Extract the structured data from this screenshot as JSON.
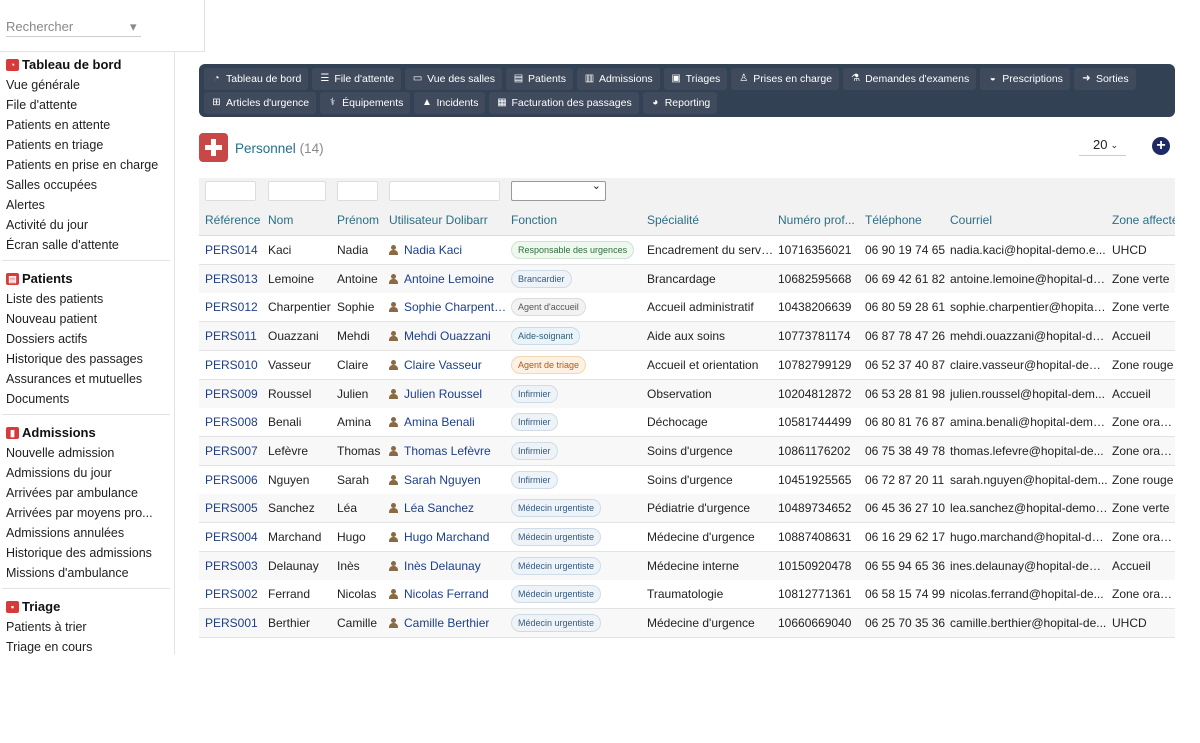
{
  "search": {
    "placeholder": "Rechercher"
  },
  "sidebar": {
    "sections": [
      {
        "title": "Tableau de bord",
        "icon": "dashboard-icon",
        "items": [
          "Vue générale",
          "File d'attente",
          "Patients en attente",
          "Patients en triage",
          "Patients en prise en charge",
          "Salles occupées",
          "Alertes",
          "Activité du jour",
          "Écran salle d'attente"
        ]
      },
      {
        "title": "Patients",
        "icon": "patient-card-icon",
        "items": [
          "Liste des patients",
          "Nouveau patient",
          "Dossiers actifs",
          "Historique des passages",
          "Assurances et mutuelles",
          "Documents"
        ]
      },
      {
        "title": "Admissions",
        "icon": "admissions-icon",
        "items": [
          "Nouvelle admission",
          "Admissions du jour",
          "Arrivées par ambulance",
          "Arrivées par moyens pro...",
          "Admissions annulées",
          "Historique des admissions",
          "Missions d'ambulance"
        ]
      },
      {
        "title": "Triage",
        "icon": "triage-icon",
        "items": [
          "Patients à trier",
          "Triage en cours"
        ]
      }
    ]
  },
  "topnav": {
    "row1": [
      {
        "label": "Tableau de bord",
        "icon": "dashboard-icon"
      },
      {
        "label": "File d'attente",
        "icon": "list-icon"
      },
      {
        "label": "Vue des salles",
        "icon": "bed-icon"
      },
      {
        "label": "Patients",
        "icon": "id-card-icon"
      },
      {
        "label": "Admissions",
        "icon": "building-icon"
      },
      {
        "label": "Triages",
        "icon": "clipboard-icon"
      },
      {
        "label": "Prises en charge",
        "icon": "doctor-icon"
      },
      {
        "label": "Demandes d'examens",
        "icon": "flask-icon"
      },
      {
        "label": "Prescriptions",
        "icon": "pills-icon"
      },
      {
        "label": "Sorties",
        "icon": "exit-icon"
      }
    ],
    "row2": [
      {
        "label": "Articles d'urgence",
        "icon": "sitemap-icon"
      },
      {
        "label": "Équipements",
        "icon": "stethoscope-icon"
      },
      {
        "label": "Incidents",
        "icon": "warning-icon"
      },
      {
        "label": "Facturation des passages",
        "icon": "invoice-icon"
      },
      {
        "label": "Reporting",
        "icon": "pie-chart-icon"
      }
    ]
  },
  "page": {
    "title": "Personnel",
    "count": "(14)",
    "page_size": "20"
  },
  "table": {
    "headers": [
      "Référence",
      "Nom",
      "Prénom",
      "Utilisateur Dolibarr",
      "Fonction",
      "Spécialité",
      "Numéro prof...",
      "Téléphone",
      "Courriel",
      "Zone affectée"
    ],
    "rows": [
      {
        "ref": "PERS014",
        "nom": "Kaci",
        "prenom": "Nadia",
        "user": "Nadia Kaci",
        "fonction": "Responsable des urgences",
        "fcolor": "green",
        "specialite": "Encadrement du service",
        "numero": "10716356021",
        "tel": "06 90 19 74 65",
        "email": "nadia.kaci@hopital-demo.e...",
        "zone": "UHCD"
      },
      {
        "ref": "PERS013",
        "nom": "Lemoine",
        "prenom": "Antoine",
        "user": "Antoine Lemoine",
        "fonction": "Brancardier",
        "fcolor": "blue",
        "specialite": "Brancardage",
        "numero": "10682595668",
        "tel": "06 69 42 61 82",
        "email": "antoine.lemoine@hopital-de...",
        "zone": "Zone verte"
      },
      {
        "ref": "PERS012",
        "nom": "Charpentier",
        "prenom": "Sophie",
        "user": "Sophie Charpentier",
        "fonction": "Agent d'accueil",
        "fcolor": "grey",
        "specialite": "Accueil administratif",
        "numero": "10438206639",
        "tel": "06 80 59 28 61",
        "email": "sophie.charpentier@hopital-...",
        "zone": "Zone verte"
      },
      {
        "ref": "PERS011",
        "nom": "Ouazzani",
        "prenom": "Mehdi",
        "user": "Mehdi Ouazzani",
        "fonction": "Aide-soignant",
        "fcolor": "teal",
        "specialite": "Aide aux soins",
        "numero": "10773781174",
        "tel": "06 87 78 47 26",
        "email": "mehdi.ouazzani@hopital-de...",
        "zone": "Accueil"
      },
      {
        "ref": "PERS010",
        "nom": "Vasseur",
        "prenom": "Claire",
        "user": "Claire Vasseur",
        "fonction": "Agent de triage",
        "fcolor": "orange",
        "specialite": "Accueil et orientation",
        "numero": "10782799129",
        "tel": "06 52 37 40 87",
        "email": "claire.vasseur@hopital-dem...",
        "zone": "Zone rouge"
      },
      {
        "ref": "PERS009",
        "nom": "Roussel",
        "prenom": "Julien",
        "user": "Julien Roussel",
        "fonction": "Infirmier",
        "fcolor": "blue",
        "specialite": "Observation",
        "numero": "10204812872",
        "tel": "06 53 28 81 98",
        "email": "julien.roussel@hopital-dem...",
        "zone": "Accueil"
      },
      {
        "ref": "PERS008",
        "nom": "Benali",
        "prenom": "Amina",
        "user": "Amina Benali",
        "fonction": "Infirmier",
        "fcolor": "blue",
        "specialite": "Déchocage",
        "numero": "10581744499",
        "tel": "06 80 81 76 87",
        "email": "amina.benali@hopital-demo...",
        "zone": "Zone orange"
      },
      {
        "ref": "PERS007",
        "nom": "Lefèvre",
        "prenom": "Thomas",
        "user": "Thomas Lefèvre",
        "fonction": "Infirmier",
        "fcolor": "blue",
        "specialite": "Soins d'urgence",
        "numero": "10861176202",
        "tel": "06 75 38 49 78",
        "email": "thomas.lefevre@hopital-de...",
        "zone": "Zone orange"
      },
      {
        "ref": "PERS006",
        "nom": "Nguyen",
        "prenom": "Sarah",
        "user": "Sarah Nguyen",
        "fonction": "Infirmier",
        "fcolor": "blue",
        "specialite": "Soins d'urgence",
        "numero": "10451925565",
        "tel": "06 72 87 20 11",
        "email": "sarah.nguyen@hopital-dem...",
        "zone": "Zone rouge"
      },
      {
        "ref": "PERS005",
        "nom": "Sanchez",
        "prenom": "Léa",
        "user": "Léa Sanchez",
        "fonction": "Médecin urgentiste",
        "fcolor": "blue",
        "specialite": "Pédiatrie d'urgence",
        "numero": "10489734652",
        "tel": "06 45 36 27 10",
        "email": "lea.sanchez@hopital-demo....",
        "zone": "Zone verte"
      },
      {
        "ref": "PERS004",
        "nom": "Marchand",
        "prenom": "Hugo",
        "user": "Hugo Marchand",
        "fonction": "Médecin urgentiste",
        "fcolor": "blue",
        "specialite": "Médecine d'urgence",
        "numero": "10887408631",
        "tel": "06 16 29 62 17",
        "email": "hugo.marchand@hopital-de...",
        "zone": "Zone orange"
      },
      {
        "ref": "PERS003",
        "nom": "Delaunay",
        "prenom": "Inès",
        "user": "Inès Delaunay",
        "fonction": "Médecin urgentiste",
        "fcolor": "blue",
        "specialite": "Médecine interne",
        "numero": "10150920478",
        "tel": "06 55 94 65 36",
        "email": "ines.delaunay@hopital-dem...",
        "zone": "Accueil"
      },
      {
        "ref": "PERS002",
        "nom": "Ferrand",
        "prenom": "Nicolas",
        "user": "Nicolas Ferrand",
        "fonction": "Médecin urgentiste",
        "fcolor": "blue",
        "specialite": "Traumatologie",
        "numero": "10812771361",
        "tel": "06 58 15 74 99",
        "email": "nicolas.ferrand@hopital-de...",
        "zone": "Zone orange"
      },
      {
        "ref": "PERS001",
        "nom": "Berthier",
        "prenom": "Camille",
        "user": "Camille Berthier",
        "fonction": "Médecin urgentiste",
        "fcolor": "blue",
        "specialite": "Médecine d'urgence",
        "numero": "10660669040",
        "tel": "06 25 70 35 36",
        "email": "camille.berthier@hopital-de...",
        "zone": "UHCD"
      }
    ]
  }
}
